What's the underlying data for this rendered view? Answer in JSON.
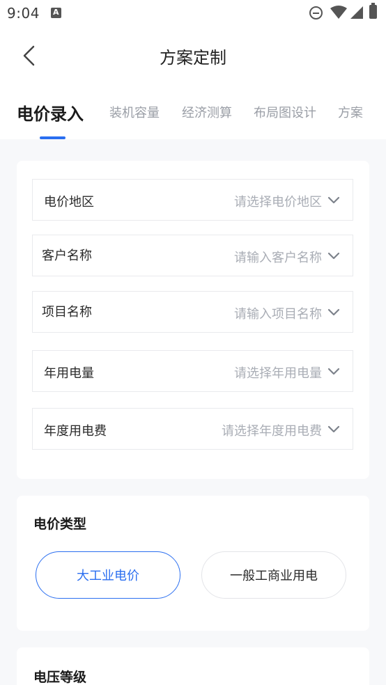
{
  "status_bar": {
    "time": "9:04"
  },
  "header": {
    "title": "方案定制"
  },
  "tabs": [
    {
      "label": "电价录入",
      "active": true
    },
    {
      "label": "装机容量",
      "active": false
    },
    {
      "label": "经济测算",
      "active": false
    },
    {
      "label": "布局图设计",
      "active": false
    },
    {
      "label": "方案",
      "active": false
    }
  ],
  "form": {
    "fields": [
      {
        "label": "电价地区",
        "placeholder": "请选择电价地区"
      },
      {
        "label": "客户名称",
        "placeholder": "请输入客户名称"
      },
      {
        "label": "项目名称",
        "placeholder": "请输入项目名称"
      },
      {
        "label": "年用电量",
        "placeholder": "请选择年用电量"
      },
      {
        "label": "年度用电费",
        "placeholder": "请选择年度用电费"
      }
    ]
  },
  "price_type": {
    "title": "电价类型",
    "options": [
      {
        "label": "大工业电价",
        "selected": true
      },
      {
        "label": "一般工商业用电",
        "selected": false
      }
    ]
  },
  "voltage": {
    "title": "电压等级"
  },
  "colors": {
    "accent": "#2a6ef0",
    "placeholder": "#a9adb5",
    "page_bg": "#f7f8fa"
  }
}
